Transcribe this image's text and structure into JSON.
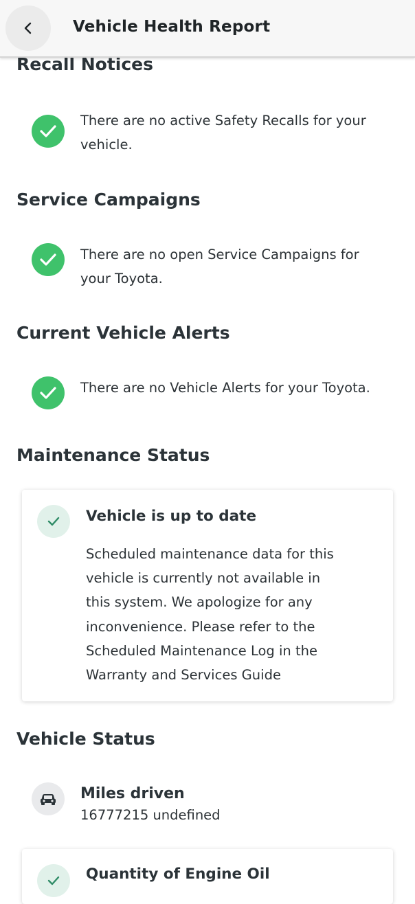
{
  "header": {
    "title": "Vehicle Health Report",
    "back_icon": "chevron-left-icon"
  },
  "sections": {
    "recall": {
      "title": "Recall Notices",
      "message": "There are no active Safety Recalls for your vehicle.",
      "icon": "check-circle-icon"
    },
    "service_campaigns": {
      "title": "Service Campaigns",
      "message": "There are no open Service Campaigns for your Toyota.",
      "icon": "check-circle-icon"
    },
    "alerts": {
      "title": "Current Vehicle Alerts",
      "message": "There are no Vehicle Alerts for your Toyota.",
      "icon": "check-circle-icon"
    },
    "maintenance": {
      "title": "Maintenance Status",
      "card_title": "Vehicle is up to date",
      "card_description": "Scheduled maintenance data for this vehicle is currently not available in this system. We apologize for any inconvenience. Please refer to the Scheduled Maintenance Log in the Warranty and Services Guide",
      "icon": "check-icon"
    },
    "vehicle_status": {
      "title": "Vehicle Status",
      "miles_label": "Miles driven",
      "miles_value": "16777215 undefined",
      "miles_icon": "car-icon",
      "oil_card_title": "Quantity of Engine Oil"
    }
  },
  "colors": {
    "success_green": "#3fc26b",
    "light_green": "#e1f1ea",
    "check_dark_green": "#2e8b66",
    "text_dark": "#2b3338"
  }
}
